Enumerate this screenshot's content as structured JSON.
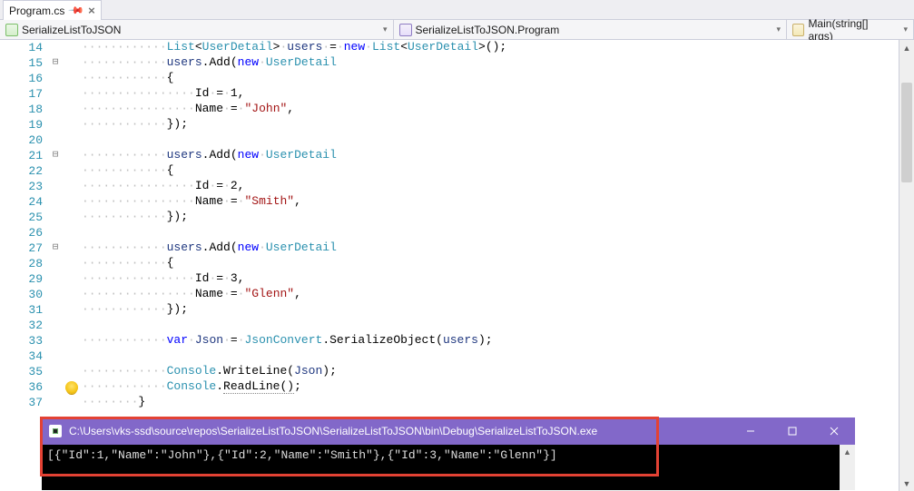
{
  "tab": {
    "title": "Program.cs"
  },
  "nav": {
    "project": "SerializeListToJSON",
    "class": "SerializeListToJSON.Program",
    "method": "Main(string[] args)"
  },
  "code": {
    "first_line_no": 14,
    "tokens": {
      "list": "List",
      "userdetail": "UserDetail",
      "users": "users",
      "new": "new",
      "add": "Add",
      "id": "Id",
      "name": "Name",
      "john": "\"John\"",
      "smith": "\"Smith\"",
      "glenn": "\"Glenn\"",
      "var": "var",
      "json": "Json",
      "jsonconvert": "JsonConvert",
      "serializeobject": "SerializeObject",
      "console": "Console",
      "writeline": "WriteLine",
      "readline": "ReadLine"
    }
  },
  "console": {
    "title": "C:\\Users\\vks-ssd\\source\\repos\\SerializeListToJSON\\SerializeListToJSON\\bin\\Debug\\SerializeListToJSON.exe",
    "output": "[{\"Id\":1,\"Name\":\"John\"},{\"Id\":2,\"Name\":\"Smith\"},{\"Id\":3,\"Name\":\"Glenn\"}]"
  }
}
